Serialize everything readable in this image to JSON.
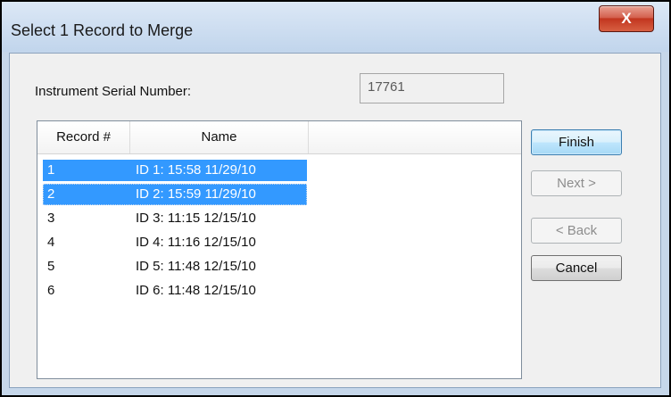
{
  "window": {
    "title": "Select 1 Record to Merge",
    "close_label": "X"
  },
  "serial": {
    "label": "Instrument Serial Number:",
    "value": "17761"
  },
  "list": {
    "columns": [
      "Record #",
      "Name",
      ""
    ],
    "rows": [
      {
        "record": "1",
        "name": "ID 1: 15:58 11/29/10",
        "selected": true
      },
      {
        "record": "2",
        "name": "ID 2: 15:59 11/29/10",
        "selected": true
      },
      {
        "record": "3",
        "name": "ID 3: 11:15 12/15/10",
        "selected": false
      },
      {
        "record": "4",
        "name": "ID 4: 11:16 12/15/10",
        "selected": false
      },
      {
        "record": "5",
        "name": "ID 5: 11:48 12/15/10",
        "selected": false
      },
      {
        "record": "6",
        "name": "ID 6: 11:48 12/15/10",
        "selected": false
      }
    ]
  },
  "buttons": {
    "finish": "Finish",
    "next": "Next >",
    "back": "< Back",
    "cancel": "Cancel"
  }
}
